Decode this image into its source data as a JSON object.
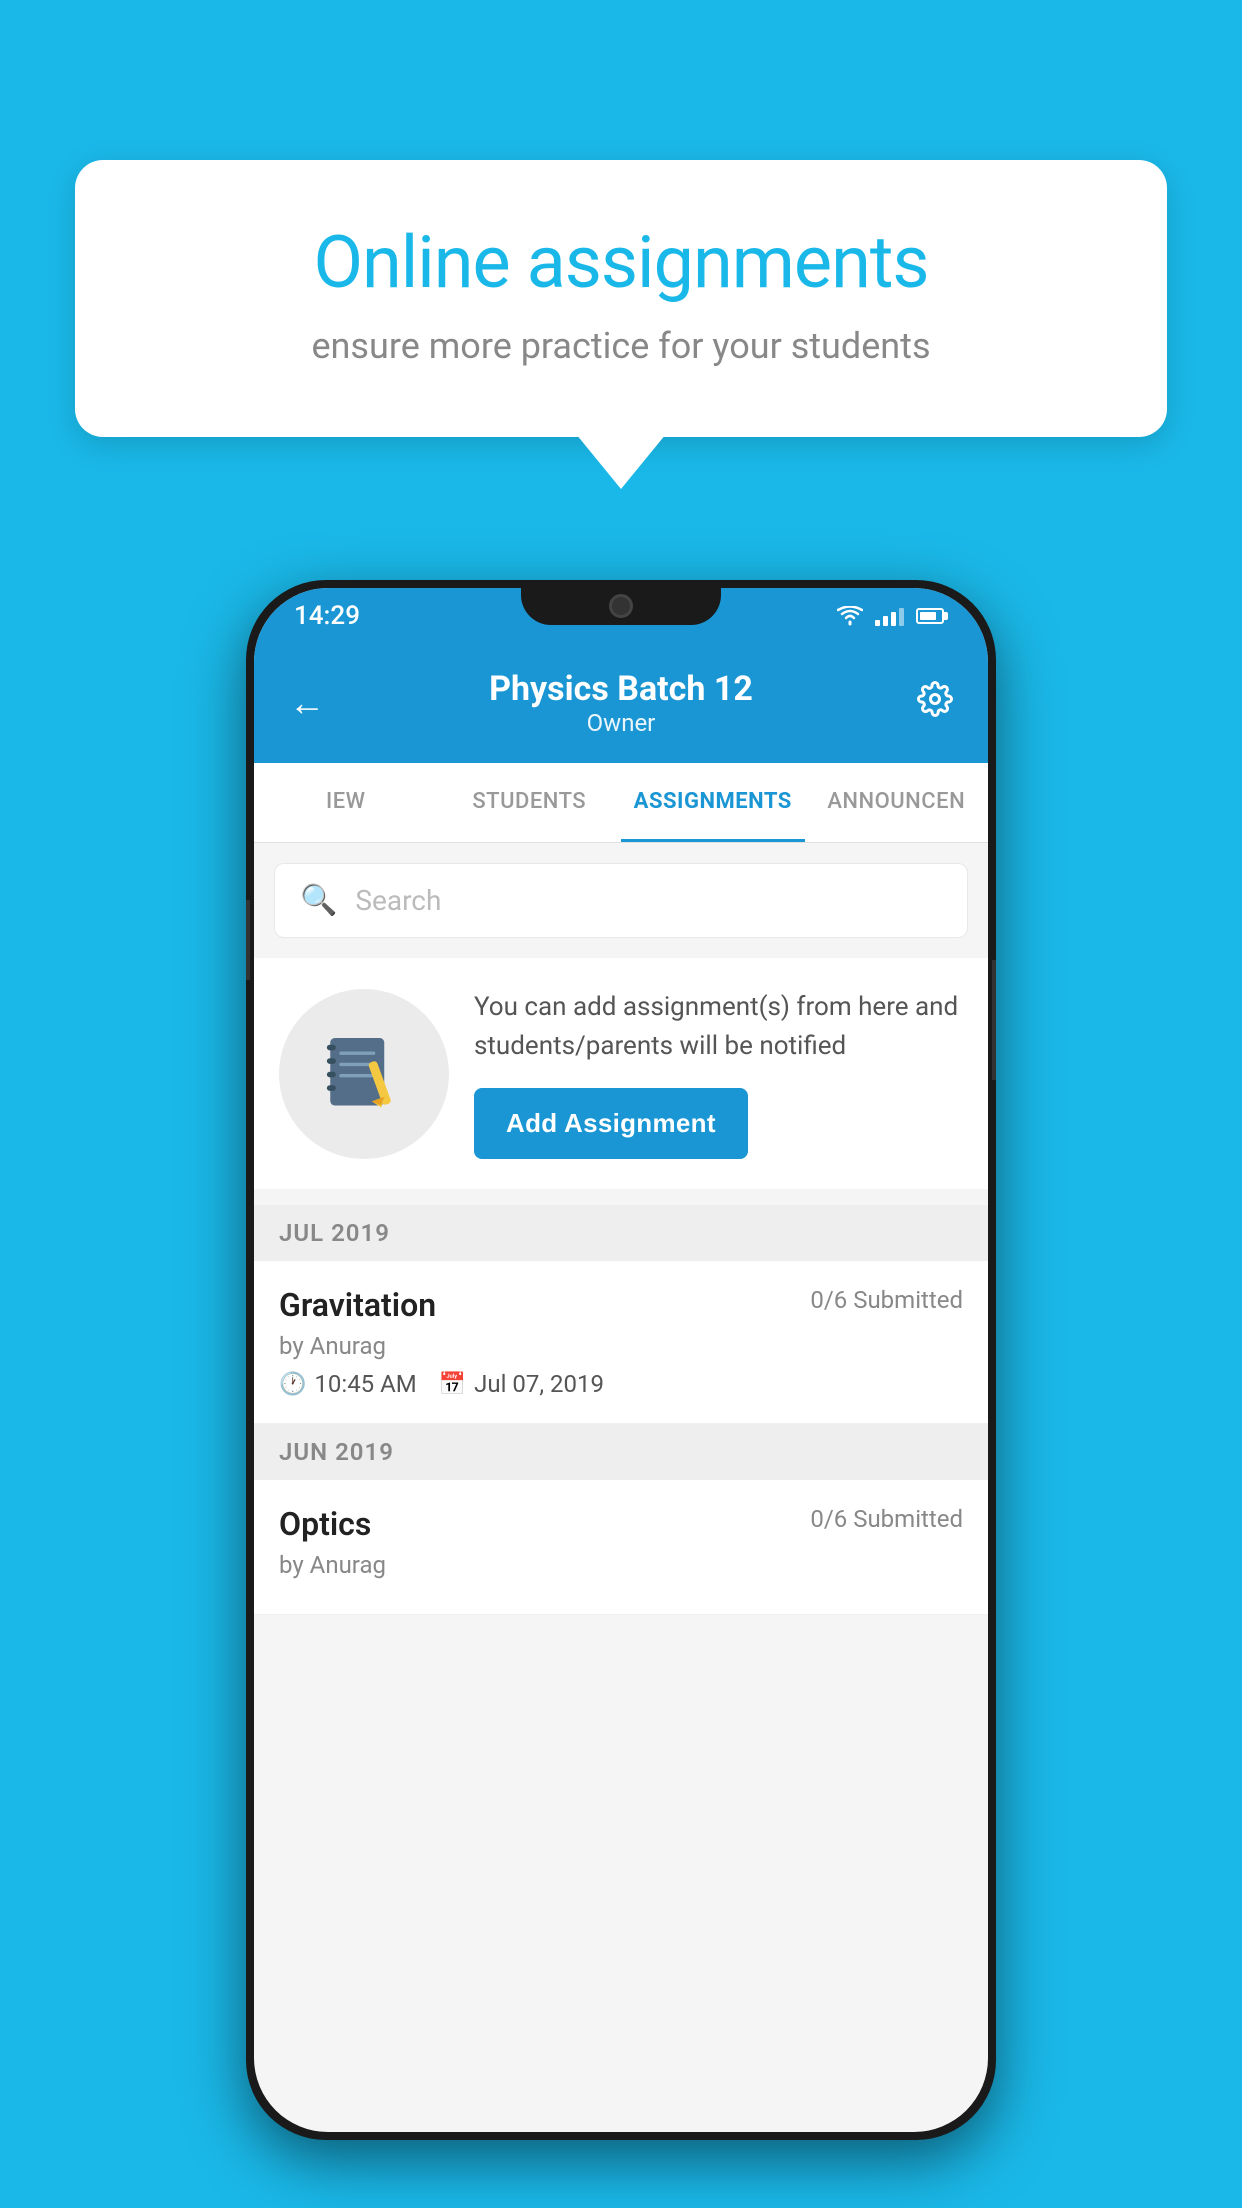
{
  "bubble": {
    "title": "Online assignments",
    "subtitle": "ensure more practice for your students"
  },
  "phone": {
    "status_bar": {
      "time": "14:29"
    },
    "header": {
      "title": "Physics Batch 12",
      "subtitle": "Owner"
    },
    "tabs": [
      {
        "label": "IEW",
        "active": false
      },
      {
        "label": "STUDENTS",
        "active": false
      },
      {
        "label": "ASSIGNMENTS",
        "active": true
      },
      {
        "label": "ANNOUNCEN",
        "active": false
      }
    ],
    "search": {
      "placeholder": "Search"
    },
    "promo": {
      "description": "You can add assignment(s) from here and students/parents will be notified",
      "button_label": "Add Assignment"
    },
    "sections": [
      {
        "month": "JUL 2019",
        "assignments": [
          {
            "name": "Gravitation",
            "status": "0/6 Submitted",
            "by": "by Anurag",
            "time": "10:45 AM",
            "date": "Jul 07, 2019"
          }
        ]
      },
      {
        "month": "JUN 2019",
        "assignments": [
          {
            "name": "Optics",
            "status": "0/6 Submitted",
            "by": "by Anurag",
            "time": "",
            "date": ""
          }
        ]
      }
    ]
  }
}
